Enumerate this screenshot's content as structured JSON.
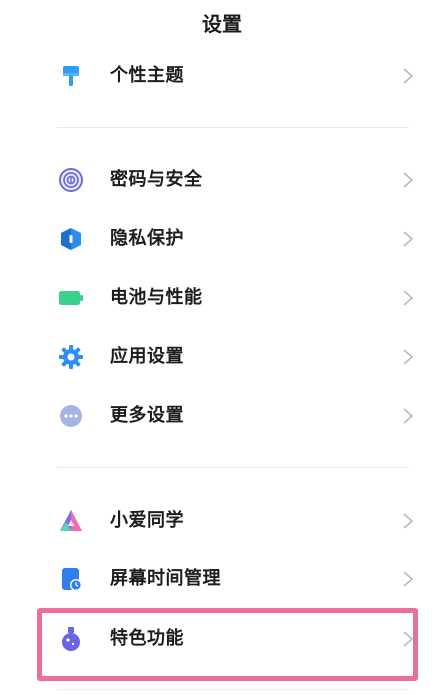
{
  "header": {
    "title": "设置"
  },
  "items": [
    {
      "label": "个性主题",
      "icon": "theme-brush-icon",
      "color": "#2f9df4"
    },
    {
      "label": "密码与安全",
      "icon": "fingerprint-icon",
      "color": "#6c6fd6"
    },
    {
      "label": "隐私保护",
      "icon": "privacy-shield-icon",
      "color": "#2d8cf0"
    },
    {
      "label": "电池与性能",
      "icon": "battery-icon",
      "color": "#3ccf8e"
    },
    {
      "label": "应用设置",
      "icon": "app-gear-icon",
      "color": "#2f8ff0"
    },
    {
      "label": "更多设置",
      "icon": "more-dots-icon",
      "color": "#a7b3e0"
    },
    {
      "label": "小爱同学",
      "icon": "xiaoai-icon",
      "color": "#7d6af3"
    },
    {
      "label": "屏幕时间管理",
      "icon": "screen-time-icon",
      "color": "#2f7ff0"
    },
    {
      "label": "特色功能",
      "icon": "feature-flask-icon",
      "color": "#6b63ea"
    }
  ],
  "colors": {
    "highlight_border": "#ea6f9a",
    "chevron": "#b9b9b9",
    "divider": "#e9e9e9"
  }
}
